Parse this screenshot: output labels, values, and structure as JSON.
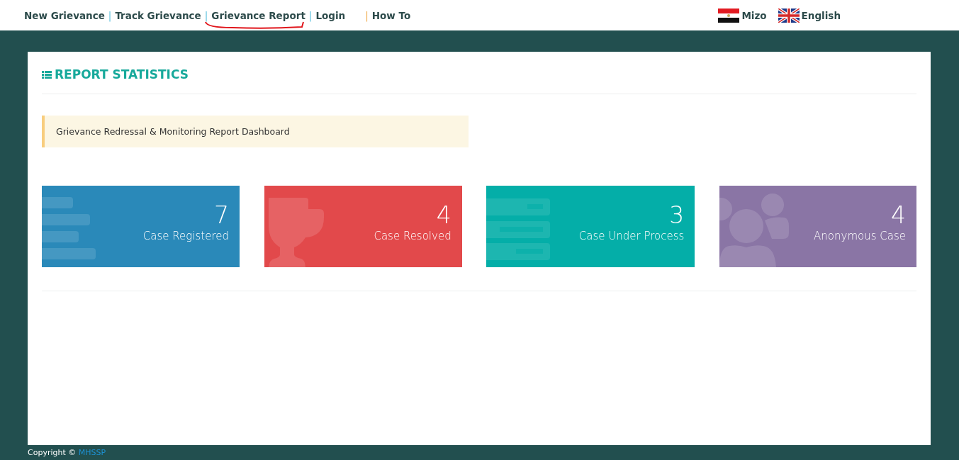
{
  "nav": {
    "links": [
      {
        "label": "New Grievance"
      },
      {
        "separator": {
          "text": "|",
          "kind": "plain"
        },
        "label": "Track Grievance"
      },
      {
        "separator": {
          "text": "|",
          "kind": "plain"
        },
        "label": "Grievance Report"
      },
      {
        "separator": {
          "text": "|",
          "kind": "plain"
        },
        "label": "Login"
      },
      {
        "separator": {
          "text": "|",
          "kind": "accent"
        },
        "label": "How To"
      }
    ],
    "languages": [
      {
        "kind": "tricolor",
        "label": "Mizo"
      },
      {
        "kind": "union",
        "label": "English"
      }
    ]
  },
  "panel": {
    "title": "REPORT STATISTICS",
    "notice": "Grievance Redressal & Monitoring Report Dashboard",
    "tiles": [
      {
        "kind": "bars",
        "color": "#2a89b9",
        "value": "7",
        "label": "Case Registered"
      },
      {
        "kind": "trophy",
        "color": "#e2494b",
        "value": "4",
        "label": "Case Resolved"
      },
      {
        "kind": "server",
        "color": "#04aea8",
        "value": "3",
        "label": "Case Under Process"
      },
      {
        "kind": "users",
        "color": "#8a75a5",
        "value": "4",
        "label": "Anonymous Case"
      }
    ]
  },
  "footer": {
    "text": "Copyright ©",
    "link": "MHSSP"
  }
}
